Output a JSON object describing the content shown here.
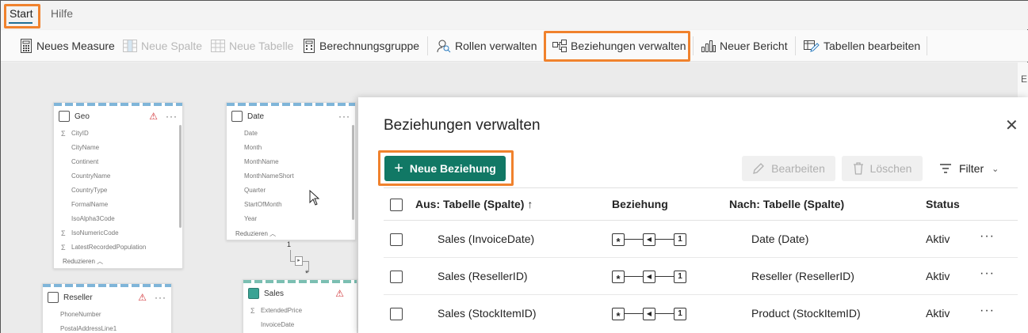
{
  "menu": {
    "tabs": [
      {
        "label": "Start",
        "active": true
      },
      {
        "label": "Hilfe",
        "active": false
      }
    ]
  },
  "ribbon": {
    "new_measure": "Neues Measure",
    "new_column": "Neue Spalte",
    "new_table": "Neue Tabelle",
    "calc_group": "Berechnungsgruppe",
    "manage_roles": "Rollen verwalten",
    "manage_relationships": "Beziehungen verwalten",
    "new_report": "Neuer Bericht",
    "edit_tables": "Tabellen bearbeiten"
  },
  "model": {
    "geo": {
      "title": "Geo",
      "fields": [
        "CityID",
        "CityName",
        "Continent",
        "CountryName",
        "CountryType",
        "FormalName",
        "IsoAlpha3Code",
        "IsoNumericCode",
        "LatestRecordedPopulation"
      ],
      "sum_fields": [
        "CityID",
        "IsoNumericCode",
        "LatestRecordedPopulation"
      ],
      "reduce": "Reduzieren"
    },
    "date": {
      "title": "Date",
      "fields": [
        "Date",
        "Month",
        "MonthName",
        "MonthNameShort",
        "Quarter",
        "StartOfMonth",
        "Year"
      ],
      "reduce": "Reduzieren"
    },
    "reseller": {
      "title": "Reseller",
      "fields": [
        "PhoneNumber",
        "PostalAddressLine1"
      ]
    },
    "sales": {
      "title": "Sales",
      "fields": [
        "ExtendedPrice",
        "InvoiceDate"
      ]
    },
    "rel_one": "1",
    "rel_many": "*"
  },
  "right_strip_label": "E",
  "dialog": {
    "title": "Beziehungen verwalten",
    "new_button": "Neue Beziehung",
    "edit_button": "Bearbeiten",
    "delete_button": "Löschen",
    "filter_label": "Filter",
    "columns": {
      "from": "Aus: Tabelle (Spalte)",
      "relationship": "Beziehung",
      "to": "Nach: Tabelle (Spalte)",
      "status": "Status"
    },
    "rows": [
      {
        "from": "Sales (InvoiceDate)",
        "many": "*",
        "one": "1",
        "to": "Date (Date)",
        "status": "Aktiv"
      },
      {
        "from": "Sales (ResellerID)",
        "many": "*",
        "one": "1",
        "to": "Reseller (ResellerID)",
        "status": "Aktiv"
      },
      {
        "from": "Sales (StockItemID)",
        "many": "*",
        "one": "1",
        "to": "Product (StockItemID)",
        "status": "Aktiv"
      }
    ]
  },
  "colors": {
    "accent": "#117865",
    "highlight": "#f0822d",
    "warning": "#d13438"
  }
}
